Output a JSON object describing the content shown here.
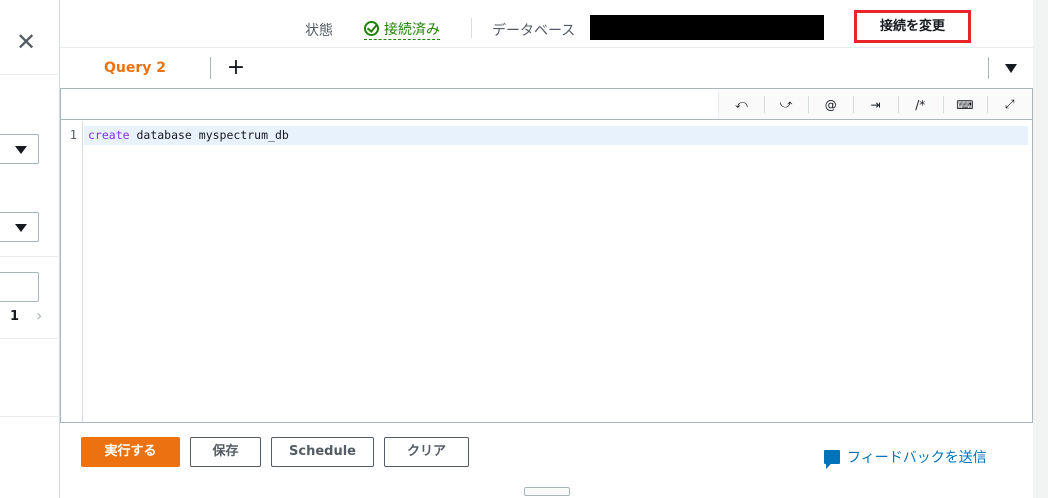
{
  "left_panel": {
    "close_icon": "close-icon",
    "page_number": "1"
  },
  "status": {
    "state_label": "状態",
    "state_value": "接続済み",
    "state_color": "#1d8102",
    "database_label": "データベース",
    "database_value": "",
    "change_connection_label": "接続を変更",
    "highlight_color": "#e8262a"
  },
  "tabs": {
    "active_tab": "Query 2",
    "add_icon": "plus-icon",
    "menu_icon": "caret-down-icon",
    "accent_color": "#ec7211"
  },
  "toolbar": {
    "undo": "⤺",
    "redo": "⤻",
    "at": "@",
    "indent": "⇥",
    "comment": "/*",
    "keyboard": "⌨",
    "fullscreen": "⤢"
  },
  "editor": {
    "line_number": "1",
    "code_keyword": "create",
    "code_rest": " database myspectrum_db"
  },
  "actions": {
    "run_label": "実行する",
    "save_label": "保存",
    "schedule_label": "Schedule",
    "clear_label": "クリア",
    "feedback_label": "フィードバックを送信"
  }
}
